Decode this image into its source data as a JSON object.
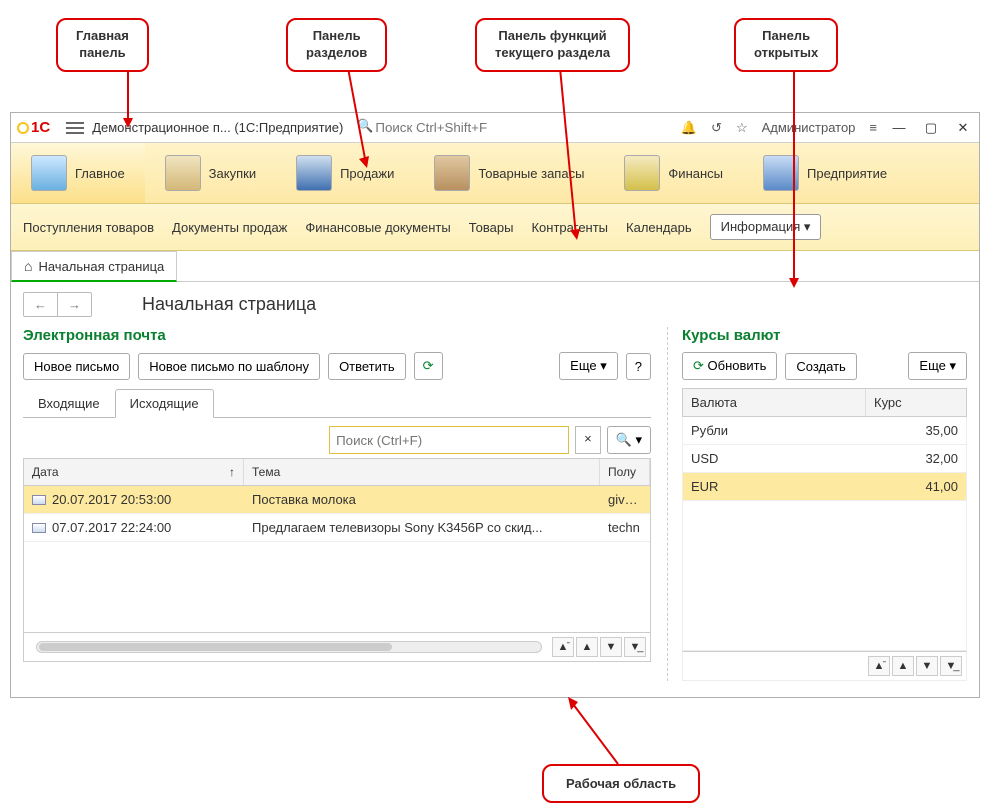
{
  "callouts": {
    "main_panel": "Главная\nпанель",
    "sections_panel": "Панель\nразделов",
    "functions_panel": "Панель функций\nтекущего раздела",
    "opened_panel": "Панель\nоткрытых",
    "work_area": "Рабочая область"
  },
  "titlebar": {
    "app_title": "Демонстрационное п... (1С:Предприятие)",
    "search_placeholder": "Поиск Ctrl+Shift+F",
    "user": "Администратор"
  },
  "sections": {
    "main": "Главное",
    "buy": "Закупки",
    "sell": "Продажи",
    "stock": "Товарные запасы",
    "fin": "Финансы",
    "ent": "Предприятие"
  },
  "functions": {
    "f1": "Поступления товаров",
    "f2": "Документы продаж",
    "f3": "Финансовые документы",
    "f4": "Товары",
    "f5": "Контрагенты",
    "f6": "Календарь",
    "info": "Информация ▾"
  },
  "opened": {
    "tab1": "Начальная страница"
  },
  "page": {
    "title": "Начальная страница"
  },
  "email": {
    "heading": "Электронная почта",
    "new": "Новое письмо",
    "new_tpl": "Новое письмо по шаблону",
    "reply": "Ответить",
    "more": "Еще ▾",
    "help": "?",
    "tab_in": "Входящие",
    "tab_out": "Исходящие",
    "search_placeholder": "Поиск (Ctrl+F)",
    "col_date": "Дата",
    "col_subj": "Тема",
    "col_recv": "Полу",
    "sort": "↑",
    "rows": [
      {
        "date": "20.07.2017 20:53:00",
        "subj": "Поставка молока",
        "recv": "givotn"
      },
      {
        "date": "07.07.2017 22:24:00",
        "subj": "Предлагаем телевизоры Sony K3456P со скид...",
        "recv": "techn"
      }
    ]
  },
  "rates": {
    "heading": "Курсы валют",
    "refresh": "Обновить",
    "create": "Создать",
    "more": "Еще ▾",
    "col_cur": "Валюта",
    "col_rate": "Курс",
    "rows": [
      {
        "c": "Рубли",
        "r": "35,00"
      },
      {
        "c": "USD",
        "r": "32,00"
      },
      {
        "c": "EUR",
        "r": "41,00"
      }
    ]
  }
}
